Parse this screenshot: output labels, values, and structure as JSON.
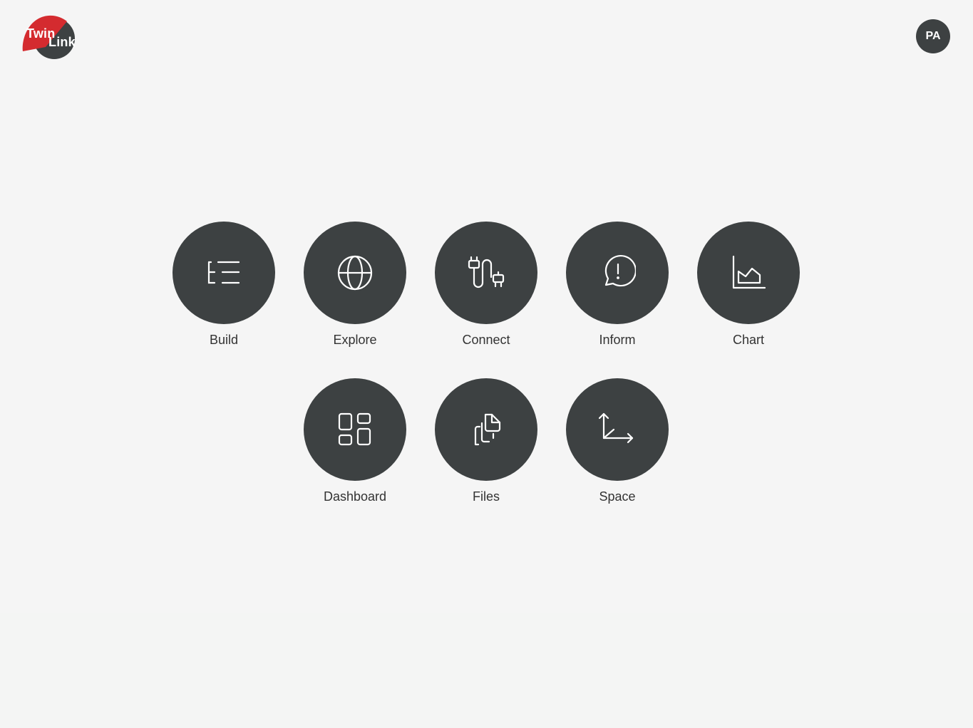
{
  "header": {
    "logo": {
      "line1": "Twin",
      "line2": "Link",
      "colors": {
        "red": "#d42b2f",
        "dark": "#3d4142"
      }
    },
    "avatar": {
      "initials": "PA"
    }
  },
  "tiles": [
    {
      "label": "Build",
      "icon": "tree-list-icon"
    },
    {
      "label": "Explore",
      "icon": "globe-icon"
    },
    {
      "label": "Connect",
      "icon": "plug-cable-icon"
    },
    {
      "label": "Inform",
      "icon": "alert-message-icon"
    },
    {
      "label": "Chart",
      "icon": "area-chart-icon"
    },
    {
      "label": "Dashboard",
      "icon": "dashboard-grid-icon"
    },
    {
      "label": "Files",
      "icon": "files-copy-icon"
    },
    {
      "label": "Space",
      "icon": "axes-3d-icon"
    }
  ],
  "colors": {
    "background": "#f5f5f5",
    "tile": "#3d4142",
    "label": "#333333",
    "icon_stroke": "#ffffff"
  }
}
